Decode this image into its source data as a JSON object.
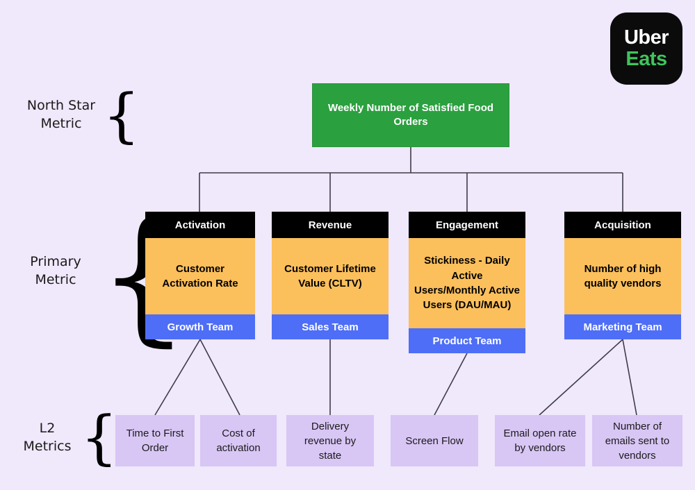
{
  "logo": {
    "line1": "Uber",
    "line2": "Eats",
    "bg": "#0b0b0b",
    "accent": "#3fc45c"
  },
  "background": "#f0e8fb",
  "row_labels": [
    {
      "id": "north-star-metric",
      "text": "North Star\nMetric"
    },
    {
      "id": "primary-metric",
      "text": "Primary\nMetric"
    },
    {
      "id": "l2-metrics",
      "text": "L2\nMetrics"
    }
  ],
  "north_star": {
    "label": "Weekly Number of Satisfied Food Orders",
    "color": "#2ba03f"
  },
  "columns": [
    {
      "id": "activation",
      "header": "Activation",
      "metric": "Customer Activation Rate",
      "team": "Growth Team"
    },
    {
      "id": "revenue",
      "header": "Revenue",
      "metric": "Customer Lifetime Value (CLTV)",
      "team": "Sales Team"
    },
    {
      "id": "engagement",
      "header": "Engagement",
      "metric": "Stickiness - Daily Active Users/Monthly Active Users (DAU/MAU)",
      "team": "Product Team"
    },
    {
      "id": "acquisition",
      "header": "Acquisition",
      "metric": "Number of high quality vendors",
      "team": "Marketing Team"
    }
  ],
  "l2_metrics": [
    {
      "id": "time-to-first-order",
      "label": "Time to First Order"
    },
    {
      "id": "cost-of-activation",
      "label": "Cost of activation"
    },
    {
      "id": "delivery-revenue-by-state",
      "label": "Delivery revenue by state"
    },
    {
      "id": "screen-flow",
      "label": "Screen Flow"
    },
    {
      "id": "email-open-rate-by-vendors",
      "label": "Email open rate by vendors"
    },
    {
      "id": "number-of-emails-sent-to-vendors",
      "label": "Number of emails sent to vendors"
    }
  ],
  "colors": {
    "header": "#000000",
    "metric": "#fbbf5c",
    "team": "#4e6ef7",
    "l2": "#d8c6f5",
    "line": "#3c3c4a"
  }
}
